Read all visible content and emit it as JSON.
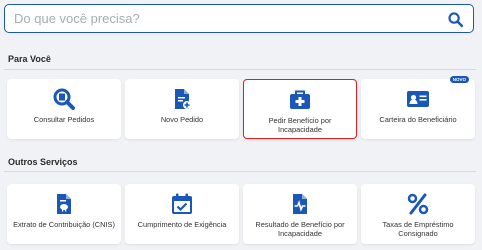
{
  "search": {
    "placeholder": "Do que você precisa?"
  },
  "sections": [
    {
      "title": "Para Você",
      "cards": [
        {
          "label": "Consultar Pedidos",
          "icon": "search-document-icon"
        },
        {
          "label": "Novo Pedido",
          "icon": "new-document-icon"
        },
        {
          "label": "Pedir Benefício por Incapacidade",
          "icon": "medical-kit-icon",
          "highlighted": true
        },
        {
          "label": "Carteira do Beneficiário",
          "icon": "id-card-icon",
          "badge": "NOVO"
        }
      ]
    },
    {
      "title": "Outros Serviços",
      "cards": [
        {
          "label": "Extrato de Contribuição (CNIS)",
          "icon": "savings-document-icon"
        },
        {
          "label": "Cumprimento de Exigência",
          "icon": "calendar-check-icon"
        },
        {
          "label": "Resultado de Benefício por Incapacidade",
          "icon": "health-document-icon"
        },
        {
          "label": "Taxas de Empréstimo Consignado",
          "icon": "percent-icon"
        }
      ]
    }
  ],
  "colors": {
    "brand": "#1a57b6",
    "highlight_border": "#e02020",
    "background": "#f1f2f5"
  }
}
